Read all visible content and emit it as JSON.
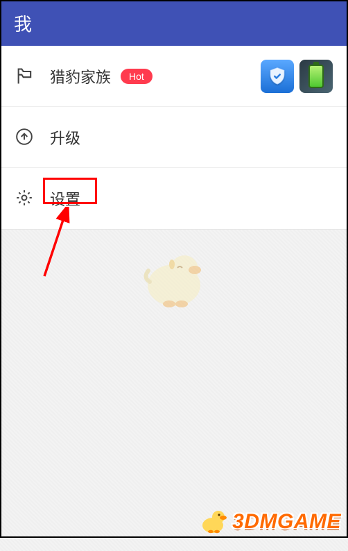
{
  "header": {
    "title": "我"
  },
  "list": [
    {
      "id": "family",
      "icon": "flag-icon",
      "label": "猎豹家族",
      "badge": "Hot",
      "apps": [
        "shield",
        "battery"
      ]
    },
    {
      "id": "upgrade",
      "icon": "arrow-up-circle-icon",
      "label": "升级"
    },
    {
      "id": "settings",
      "icon": "gear-icon",
      "label": "设置",
      "highlighted": true
    }
  ],
  "watermark": {
    "text": "3DMGAME"
  }
}
